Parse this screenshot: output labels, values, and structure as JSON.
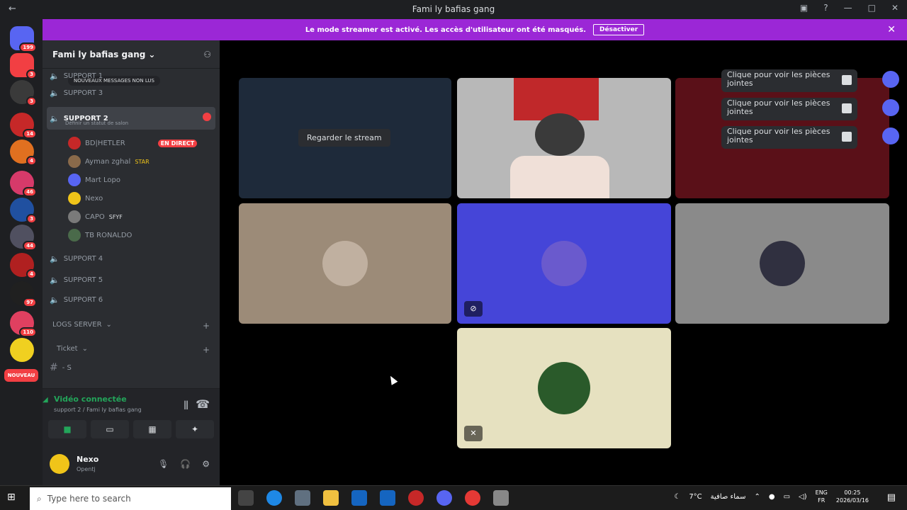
{
  "window": {
    "title": "Fami ly bafias gang",
    "back": "←"
  },
  "banner": {
    "text": "Le mode streamer est activé. Les accès d'utilisateur ont été masqués.",
    "button": "Désactiver"
  },
  "servers": {
    "badges": [
      "199",
      "3",
      "3",
      "14",
      "4",
      "46",
      "3",
      "44",
      "4",
      "97",
      "110"
    ],
    "nouveau": "NOUVEAU"
  },
  "guild": {
    "name": "Fami ly bafias gang"
  },
  "channels": {
    "unread_pill": "NOUVEAUX MESSAGES NON LUS",
    "items": [
      {
        "label": "SUPPORT 1"
      },
      {
        "label": "SUPPORT 3"
      },
      {
        "label": "SUPPORT 2",
        "active": true,
        "status": "Définir un statut de salon"
      },
      {
        "label": "SUPPORT 4"
      },
      {
        "label": "SUPPORT 5"
      },
      {
        "label": "SUPPORT 6"
      }
    ],
    "voice_users": [
      {
        "name": "BD|HETLER",
        "live": "EN DIRECT"
      },
      {
        "name": "Ayman zghal",
        "tag": "STAR"
      },
      {
        "name": "Mart Lopo"
      },
      {
        "name": "Nexo"
      },
      {
        "name": "CAPO",
        "tag": "SFYF"
      },
      {
        "name": "TB RONALDO"
      }
    ],
    "categories": [
      "LOGS SERVER",
      "Ticket"
    ],
    "ticket_channel": "- S"
  },
  "voice_panel": {
    "status": "Vidéo connectée",
    "sub": "support 2 / Fami ly bafias gang"
  },
  "user_panel": {
    "name": "Nexo",
    "status": "Opentj"
  },
  "stage": {
    "watch_stream": "Regarder le stream",
    "notifications": [
      "Clique pour voir les pièces jointes",
      "Clique pour voir les pièces jointes",
      "Clique pour voir les pièces jointes"
    ]
  },
  "taskbar": {
    "search_placeholder": "Type here to search",
    "weather": "7°C",
    "weather_desc": "سماء صافية",
    "lang": "ENG",
    "lang2": "FR",
    "time": "00:25",
    "date": "2026/03/16"
  },
  "colors": {
    "banner": "#9b27d6",
    "tile_tan": "#9c8b78",
    "tile_blue": "#4545d8",
    "tile_grey": "#8a8a8a",
    "tile_cream": "#e6e1c0",
    "tile_red": "#5a1018",
    "live_red": "#f23f43",
    "connected_green": "#23a55a"
  }
}
